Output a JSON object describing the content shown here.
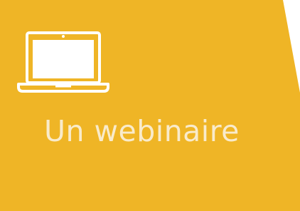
{
  "card": {
    "title": "Un webinaire",
    "icon": "laptop-icon",
    "background_color": "#EFB526",
    "icon_color": "#FFFFFF",
    "text_color": "#F9EBCB"
  }
}
